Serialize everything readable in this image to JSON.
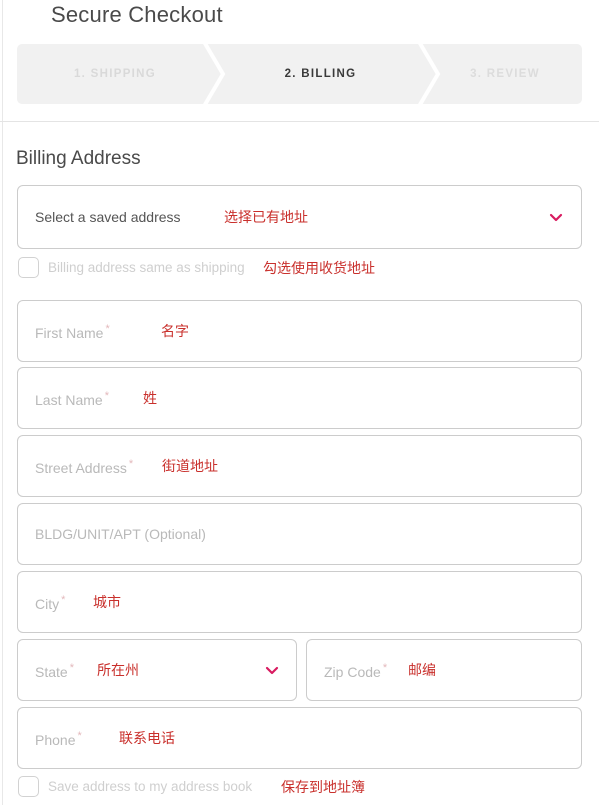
{
  "header": {
    "title": "Secure Checkout"
  },
  "stepper": {
    "steps": [
      {
        "label": "1. SHIPPING",
        "state": "complete"
      },
      {
        "label": "2. BILLING",
        "state": "active"
      },
      {
        "label": "3. REVIEW",
        "state": "upcoming"
      }
    ]
  },
  "billing": {
    "section_title": "Billing Address",
    "saved_address": {
      "label": "Select a saved address",
      "annotation": "选择已有地址",
      "caret_icon": "chevron-down-icon"
    },
    "same_as_shipping": {
      "label": "Billing address same as shipping",
      "annotation": "勾选使用收货地址",
      "checked": false
    },
    "fields": [
      {
        "name": "first-name",
        "placeholder": "First Name",
        "required_mark": "*",
        "annotation": "名字"
      },
      {
        "name": "last-name",
        "placeholder": "Last Name",
        "required_mark": "*",
        "annotation": "姓"
      },
      {
        "name": "street-address",
        "placeholder": "Street Address",
        "required_mark": "*",
        "annotation": "街道地址"
      },
      {
        "name": "bldg-unit-apt",
        "placeholder": "BLDG/UNIT/APT (Optional)",
        "required_mark": "",
        "annotation": ""
      },
      {
        "name": "city",
        "placeholder": "City",
        "required_mark": "*",
        "annotation": "城市"
      },
      {
        "name": "state",
        "placeholder": "State",
        "required_mark": "*",
        "annotation": "所在州",
        "caret_icon": "chevron-down-icon"
      },
      {
        "name": "zip-code",
        "placeholder": "Zip Code",
        "required_mark": "*",
        "annotation": "邮编"
      },
      {
        "name": "phone",
        "placeholder": "Phone",
        "required_mark": "*",
        "annotation": "联系电话"
      }
    ],
    "save_address": {
      "label": "Save address to my address book",
      "annotation": "保存到地址簿",
      "checked": false
    }
  },
  "colors": {
    "accent_caret": "#d81b60",
    "annotation_red": "#c9302c",
    "stepper_band": "#f1f1f1",
    "field_border": "#cccccc",
    "placeholder": "#b9b9b9"
  }
}
